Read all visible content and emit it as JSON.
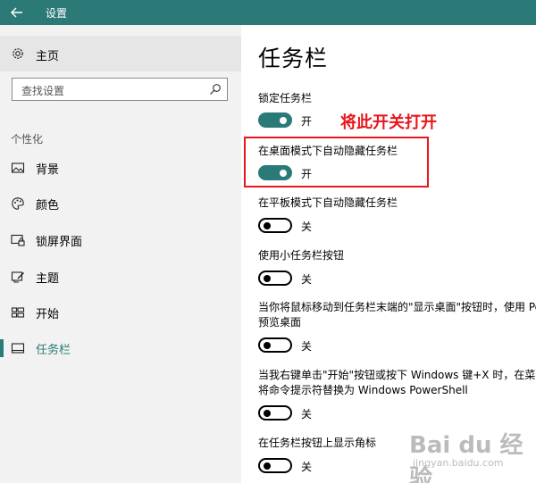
{
  "window": {
    "title": "设置",
    "accent": "#2b7a78"
  },
  "sidebar": {
    "home_label": "主页",
    "search_placeholder": "查找设置",
    "section_label": "个性化",
    "items": [
      {
        "label": "背景",
        "icon": "picture-icon"
      },
      {
        "label": "颜色",
        "icon": "palette-icon"
      },
      {
        "label": "锁屏界面",
        "icon": "lock-screen-icon"
      },
      {
        "label": "主题",
        "icon": "theme-icon"
      },
      {
        "label": "开始",
        "icon": "start-icon"
      },
      {
        "label": "任务栏",
        "icon": "taskbar-icon",
        "active": true
      }
    ]
  },
  "main": {
    "title": "任务栏",
    "settings": [
      {
        "label": "锁定任务栏",
        "state": "开",
        "on": true
      },
      {
        "label": "在桌面模式下自动隐藏任务栏",
        "state": "开",
        "on": true
      },
      {
        "label": "在平板模式下自动隐藏任务栏",
        "state": "关",
        "on": false
      },
      {
        "label": "使用小任务栏按钮",
        "state": "关",
        "on": false
      },
      {
        "label": "当你将鼠标移动到任务栏末端的\"显示桌面\"按钮时，使用 Peek 预览桌面",
        "state": "关",
        "on": false
      },
      {
        "label": "当我右键单击\"开始\"按钮或按下 Windows 键+X 时，在菜单中将命令提示符替换为 Windows PowerShell",
        "state": "关",
        "on": false
      },
      {
        "label": "在任务栏按钮上显示角标",
        "state": "关",
        "on": false
      }
    ],
    "annotation": "将此开关打开",
    "annotation_color": "#e8151b"
  },
  "watermark": {
    "brand": "Bai du 经验",
    "url": "jingyan.baidu.com"
  }
}
